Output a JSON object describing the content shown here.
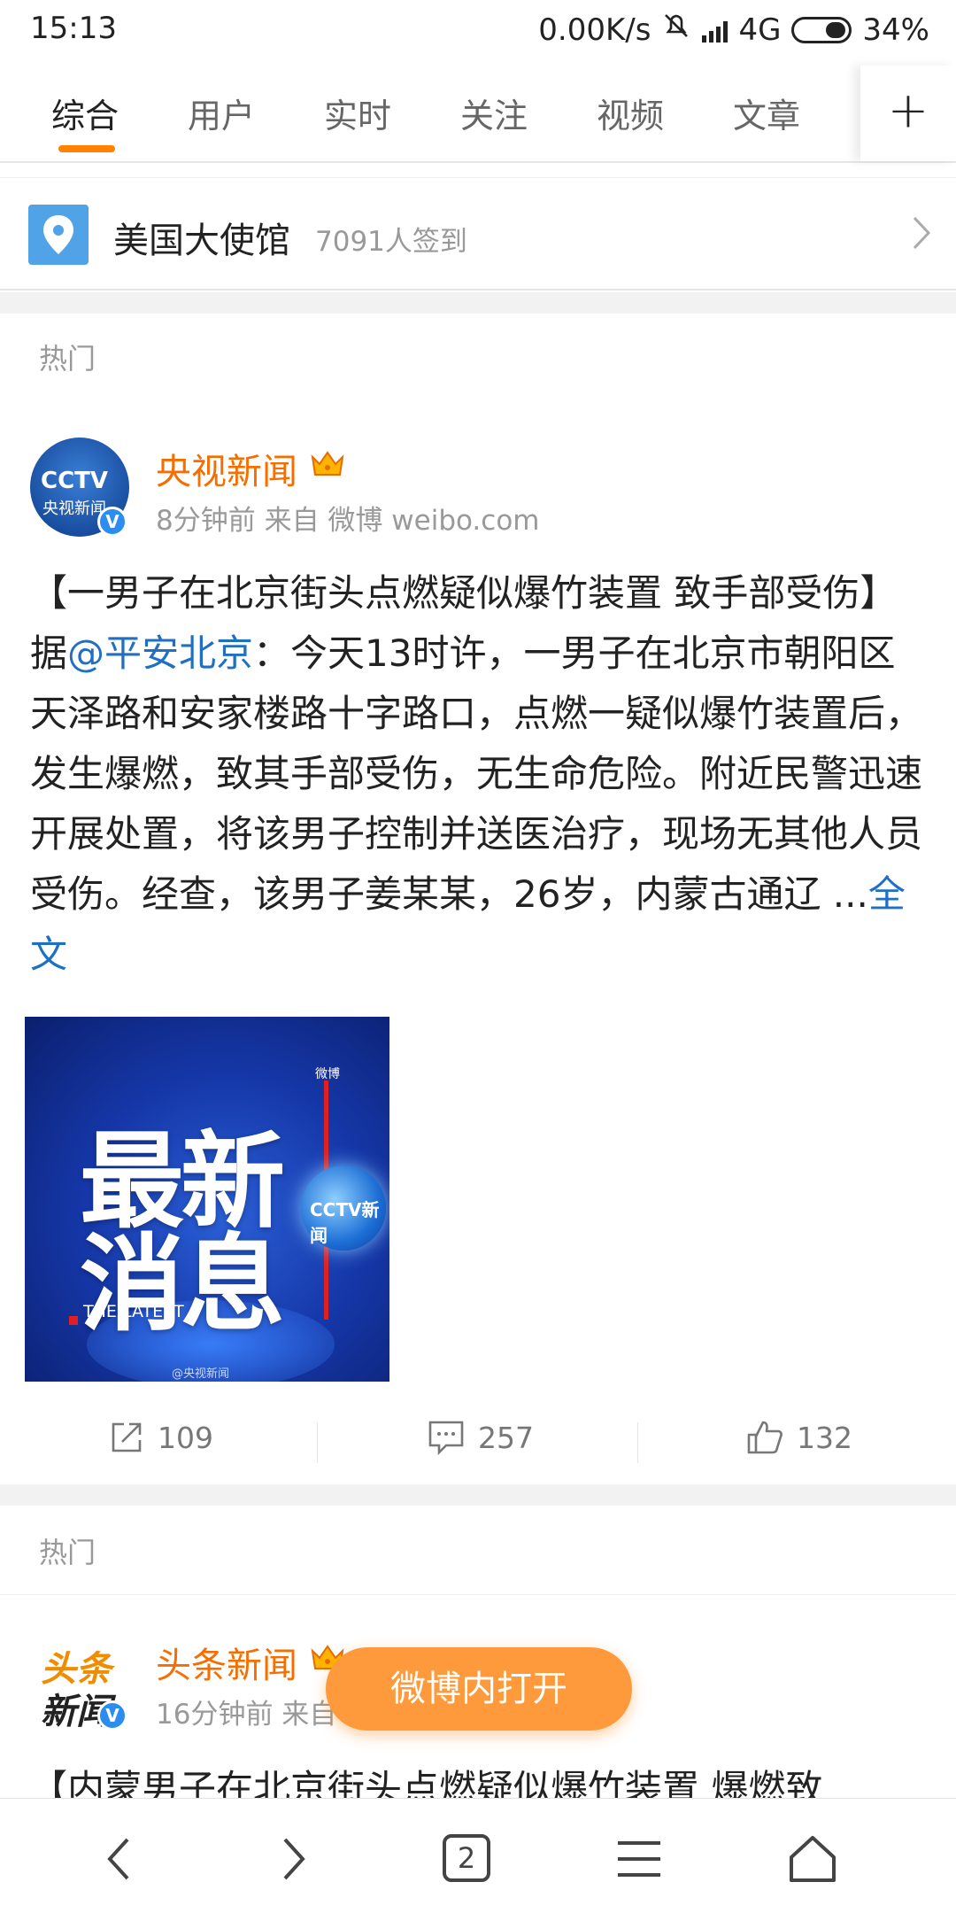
{
  "status_bar": {
    "time": "15:13",
    "net_speed": "0.00K/s",
    "network": "4G",
    "battery": "34%"
  },
  "tabs": [
    {
      "label": "综合",
      "active": true
    },
    {
      "label": "用户"
    },
    {
      "label": "实时"
    },
    {
      "label": "关注"
    },
    {
      "label": "视频"
    },
    {
      "label": "文章"
    }
  ],
  "location": {
    "name": "美国大使馆",
    "checkins": "7091人签到"
  },
  "post1": {
    "section_label": "热门",
    "author": "央视新闻",
    "meta": "8分钟前 来自 微博 weibo.com",
    "text_before_link": "【一男子在北京街头点燃疑似爆竹装置 致手部受伤】据",
    "mention": "@平安北京",
    "text_after_link": "：今天13时许，一男子在北京市朝阳区天泽路和安家楼路十字路口，点燃一疑似爆竹装置后，发生爆燃，致其手部受伤，无生命危险。附近民警迅速开展处置，将该男子控制并送医治疗，现场无其他人员受伤。经查，该男子姜某某，26岁，内蒙古通辽 ...",
    "full_text_link": "全文",
    "image": {
      "line1": "最新",
      "line2": "消息",
      "caption": "THE LATEST",
      "globe_text": "CCTV新闻",
      "watermark": "微博",
      "credit": "@央视新闻"
    },
    "reposts": "109",
    "comments": "257",
    "likes": "132"
  },
  "post2": {
    "section_label": "热门",
    "author": "头条新闻",
    "avatar_text_1": "头条",
    "avatar_text_2": "新闻",
    "meta": "16分钟前 来自",
    "text": "【内蒙男子在北京街头点燃疑似爆竹装置 爆燃致"
  },
  "floating_button": "微博内打开",
  "bottom_nav": {
    "tab_count": "2"
  },
  "colors": {
    "accent": "#ff8200",
    "author_name": "#f76d00",
    "link": "#1f6fc5",
    "open_button": "#ff9a3c"
  }
}
